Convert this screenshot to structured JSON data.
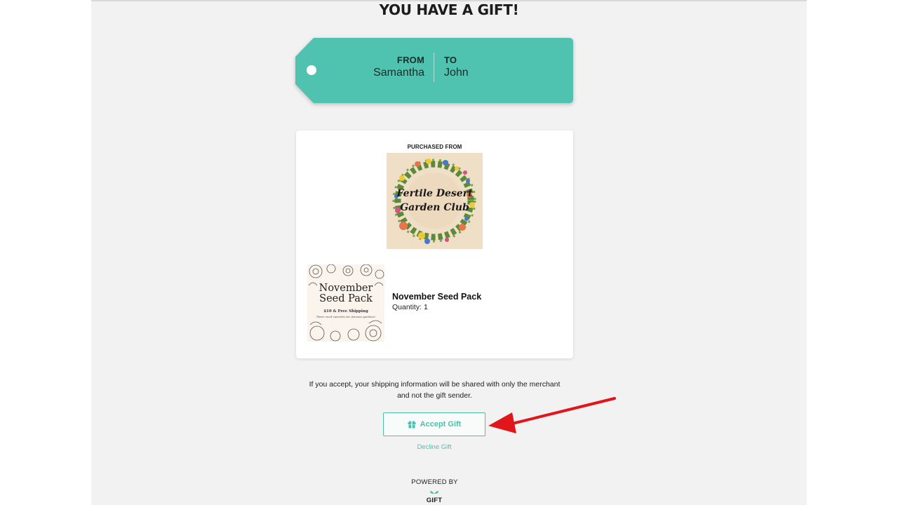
{
  "page": {
    "title": "YOU HAVE A GIFT!"
  },
  "tag": {
    "from_label": "FROM",
    "from_name": "Samantha",
    "to_label": "TO",
    "to_name": "John"
  },
  "merchant": {
    "purchased_from_label": "PURCHASED FROM",
    "logo_line1": "Fertile Desert",
    "logo_line2": "Garden Club"
  },
  "product": {
    "image_title_line1": "November",
    "image_title_line2": "Seed Pack",
    "image_subtitle": "$10 & Free Shipping",
    "image_tagline": "Three seed varieties for Arizona gardens!",
    "name": "November Seed Pack",
    "quantity_label": "Quantity:",
    "quantity_value": "1"
  },
  "notice": {
    "line1": "If you accept, your shipping information will be shared with only the merchant",
    "line2": "and not the gift sender."
  },
  "actions": {
    "accept_label": "Accept Gift",
    "accept_icon": "gift-icon",
    "decline_label": "Decline Gift"
  },
  "footer": {
    "powered_by_label": "POWERED BY",
    "brand": "GIFT"
  },
  "colors": {
    "accent": "#4fbfad",
    "tag": "#4fc2b0",
    "annotation_arrow": "#e0161b"
  }
}
